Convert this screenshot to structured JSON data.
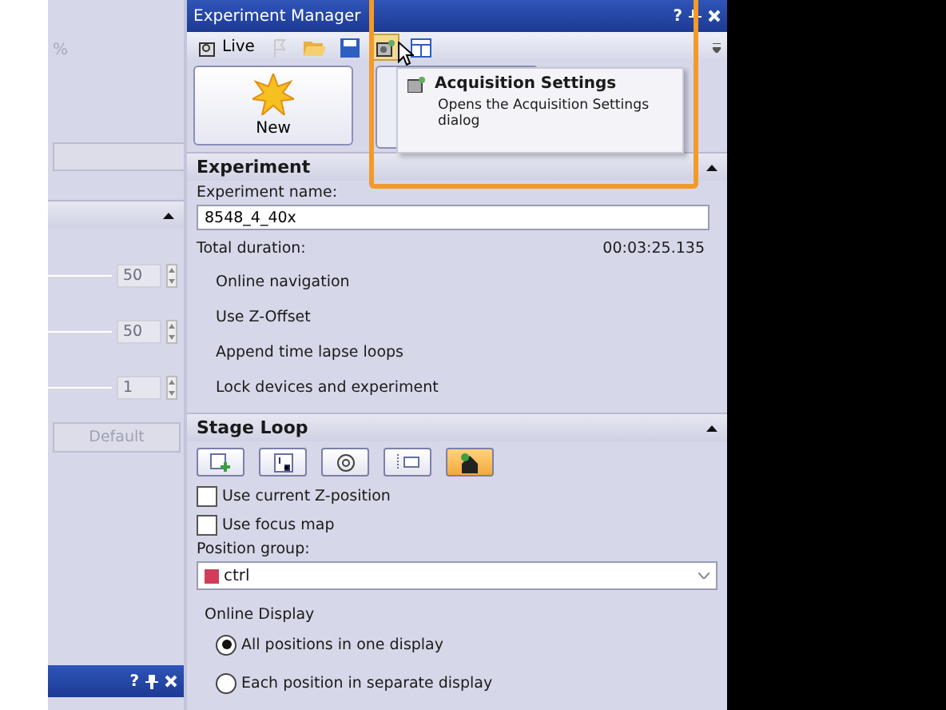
{
  "left_panel": {
    "unit": "%",
    "spinners": [
      {
        "value": "50"
      },
      {
        "value": "50"
      },
      {
        "value": "1"
      }
    ],
    "default_button": "Default",
    "bottom_title_bar": {
      "help": "?"
    }
  },
  "window": {
    "title": "Experiment Manager",
    "help": "?"
  },
  "toolbar": {
    "live_label": "Live"
  },
  "new_button": "New",
  "tooltip": {
    "title": "Acquisition Settings",
    "description": "Opens the Acquisition Settings dialog"
  },
  "experiment": {
    "header": "Experiment",
    "name_label": "Experiment name:",
    "name_value": "8548_4_40x",
    "duration_label": "Total duration:",
    "duration_value": "00:03:25.135",
    "options": [
      "Online navigation",
      "Use Z-Offset",
      "Append time lapse loops",
      "Lock devices and experiment"
    ]
  },
  "stage_loop": {
    "header": "Stage Loop",
    "tools": [
      {
        "kind": "add",
        "selected": false
      },
      {
        "kind": "order",
        "selected": false
      },
      {
        "kind": "target",
        "selected": false
      },
      {
        "kind": "list",
        "selected": false
      },
      {
        "kind": "home",
        "selected": true
      }
    ],
    "checkboxes": [
      {
        "label": "Use current Z-position",
        "checked": false
      },
      {
        "label": "Use focus map",
        "checked": false
      }
    ],
    "position_group_label": "Position group:",
    "position_group": {
      "value": "ctrl",
      "color": "#d23c5a"
    },
    "online_display_label": "Online Display",
    "radios": [
      {
        "label": "All positions in one display",
        "selected": true
      },
      {
        "label": "Each position in separate display",
        "selected": false
      }
    ]
  }
}
